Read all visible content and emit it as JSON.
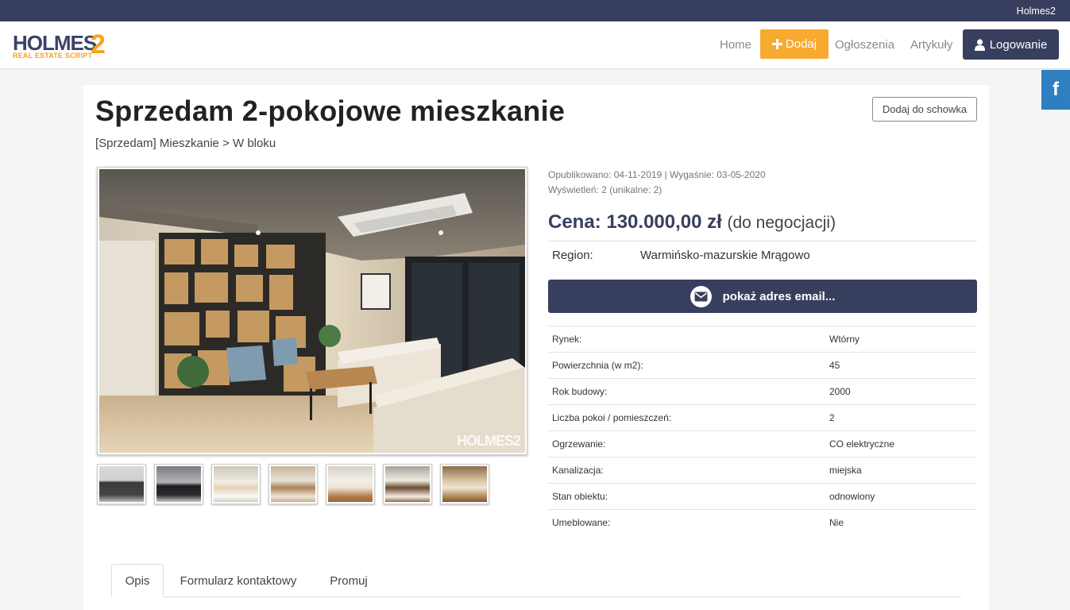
{
  "topbar": {
    "site_name": "Holmes2"
  },
  "logo": {
    "text": "HOLMES",
    "number": "2",
    "tagline": "REAL ESTATE SCRIPT"
  },
  "nav": {
    "home": "Home",
    "add": "Dodaj",
    "listings": "Ogłoszenia",
    "articles": "Artykuły",
    "login": "Logowanie"
  },
  "social": {
    "facebook": "f"
  },
  "listing": {
    "title": "Sprzedam 2-pokojowe mieszkanie",
    "clipboard_button": "Dodaj do schowka",
    "breadcrumb": "[Sprzedam] Mieszkanie > W bloku",
    "watermark": "HOLMES2",
    "meta_line1": "Opublikowano: 04-11-2019 | Wygaśnie: 03-05-2020",
    "meta_line2": "Wyświetleń: 2 (unikalne: 2)",
    "price_label": "Cena:",
    "price_value": "130.000,00 zł",
    "price_note": "(do negocjacji)",
    "region_label": "Region:",
    "region_value": "Warmińsko-mazurskie Mrągowo",
    "email_button": "pokaż adres email...",
    "attributes": [
      {
        "label": "Rynek:",
        "value": "Wtórny"
      },
      {
        "label": "Powierzchnia (w m2):",
        "value": "45"
      },
      {
        "label": "Rok budowy:",
        "value": "2000"
      },
      {
        "label": "Liczba pokoi / pomieszczeń:",
        "value": "2"
      },
      {
        "label": "Ogrzewanie:",
        "value": "CO elektryczne"
      },
      {
        "label": "Kanalizacja:",
        "value": "miejska"
      },
      {
        "label": "Stan obiektu:",
        "value": "odnowiony"
      },
      {
        "label": "Umeblowane:",
        "value": "Nie"
      }
    ]
  },
  "tabs": [
    {
      "label": "Opis"
    },
    {
      "label": "Formularz kontaktowy"
    },
    {
      "label": "Promuj"
    }
  ]
}
